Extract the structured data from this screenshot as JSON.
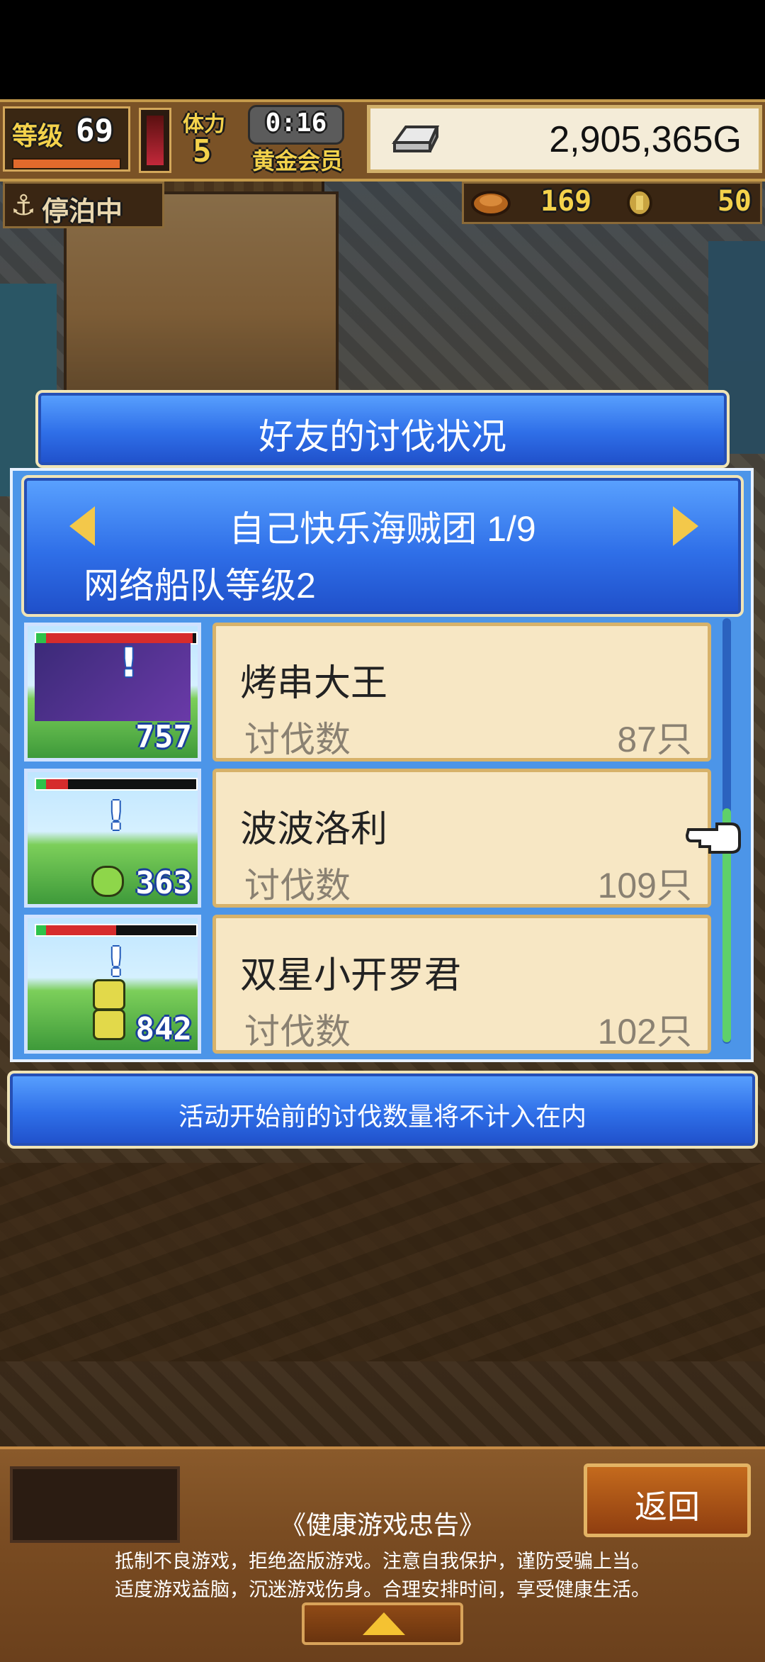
{
  "hud": {
    "level_label": "等级",
    "level_value": "69",
    "stamina_label": "体力",
    "stamina_value": "5",
    "timer": "0:16",
    "membership": "黄金会员",
    "money": "2,905,365G",
    "status": "停泊中",
    "resource_food": "169",
    "resource_coin": "50"
  },
  "dialog": {
    "title": "好友的讨伐状况",
    "team_name": "自己快乐海贼团 1/9",
    "fleet_level": "网络船队等级2",
    "rows": [
      {
        "name": "烤串大王",
        "label": "讨伐数",
        "count": "87只",
        "portrait_number": "757",
        "hp_fraction": 0.98
      },
      {
        "name": "波波洛利",
        "label": "讨伐数",
        "count": "109只",
        "portrait_number": "363",
        "hp_fraction": 0.2
      },
      {
        "name": "双星小开罗君",
        "label": "讨伐数",
        "count": "102只",
        "portrait_number": "842",
        "hp_fraction": 0.5
      }
    ],
    "notice": "活动开始前的讨伐数量将不计入在内"
  },
  "bottom": {
    "back_label": "返回",
    "advisory_title": "《健康游戏忠告》",
    "advisory_line1": "抵制不良游戏，拒绝盗版游戏。注意自我保护，谨防受骗上当。",
    "advisory_line2": "适度游戏益脑，沉迷游戏伤身。合理安排时间，享受健康生活。"
  },
  "colors": {
    "panel_blue": "#2f6fe8",
    "card_cream": "#f7e7c4",
    "accent_gold": "#f3c84a",
    "hud_brown": "#7a5226"
  },
  "icons": [
    "ingot-icon",
    "anchor-icon",
    "bread-icon",
    "coin-icon",
    "pointer-hand-icon",
    "left-arrow-icon",
    "right-arrow-icon",
    "up-arrow-icon"
  ]
}
